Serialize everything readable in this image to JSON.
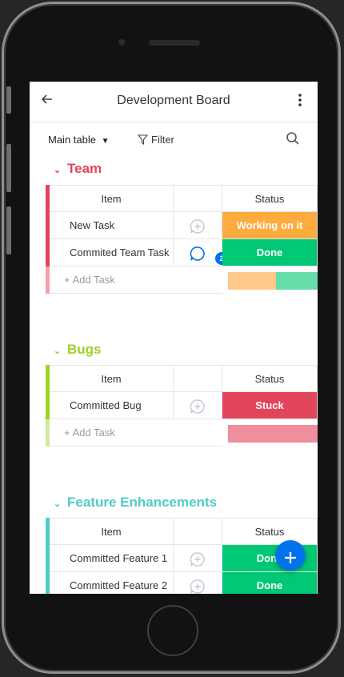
{
  "header": {
    "title": "Development Board"
  },
  "toolbar": {
    "view_label": "Main table",
    "filter_label": "Filter"
  },
  "columns": {
    "item": "Item",
    "status": "Status"
  },
  "add_task_label": "+ Add Task",
  "colors": {
    "accent": "#0073ea",
    "working": "#fdab3d",
    "done": "#00c875",
    "stuck": "#e2445c"
  },
  "groups": [
    {
      "name": "Team",
      "color": "#e2445c",
      "rows": [
        {
          "item": "New Task",
          "status": "Working on it",
          "status_color": "#fdab3d",
          "updates": ""
        },
        {
          "item": "Commited Team Task",
          "status": "Done",
          "status_color": "#00c875",
          "updates": "2"
        }
      ]
    },
    {
      "name": "Bugs",
      "color": "#9cd326",
      "rows": [
        {
          "item": "Committed Bug",
          "status": "Stuck",
          "status_color": "#e2445c",
          "updates": ""
        }
      ]
    },
    {
      "name": "Feature Enhancements",
      "color": "#4eccc6",
      "rows": [
        {
          "item": "Committed Feature 1",
          "status": "Done",
          "status_color": "#00c875",
          "updates": ""
        },
        {
          "item": "Committed Feature 2",
          "status": "Done",
          "status_color": "#00c875",
          "updates": ""
        }
      ]
    }
  ]
}
